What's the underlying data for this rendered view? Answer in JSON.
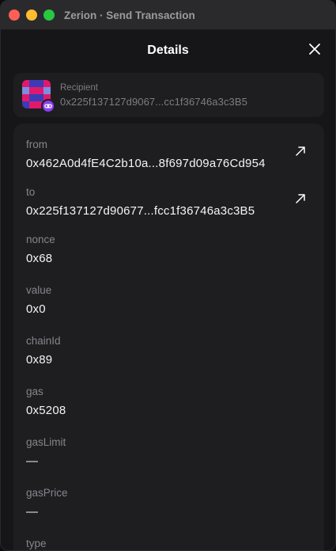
{
  "window": {
    "title": "Zerion · Send Transaction"
  },
  "header": {
    "title": "Details"
  },
  "recipient": {
    "label": "Recipient",
    "address": "0x225f137127d9067...cc1f36746a3c3B5"
  },
  "details": {
    "fields": [
      {
        "label": "from",
        "value": "0x462A0d4fE4C2b10a...8f697d09a76Cd954",
        "link_icon": "external-link-arrow"
      },
      {
        "label": "to",
        "value": "0x225f137127d90677...fcc1f36746a3c3B5",
        "link_icon": "external-link-arrow"
      },
      {
        "label": "nonce",
        "value": "0x68"
      },
      {
        "label": "value",
        "value": "0x0"
      },
      {
        "label": "chainId",
        "value": "0x89"
      },
      {
        "label": "gas",
        "value": "0x5208"
      },
      {
        "label": "gasLimit",
        "value": "—"
      },
      {
        "label": "gasPrice",
        "value": "—"
      },
      {
        "label": "type",
        "value": ""
      }
    ]
  },
  "colors": {
    "background": "#161618",
    "card": "#1e1e21",
    "label": "#85858d",
    "value": "#f4f4f6",
    "badge": "#8a3ff0"
  }
}
